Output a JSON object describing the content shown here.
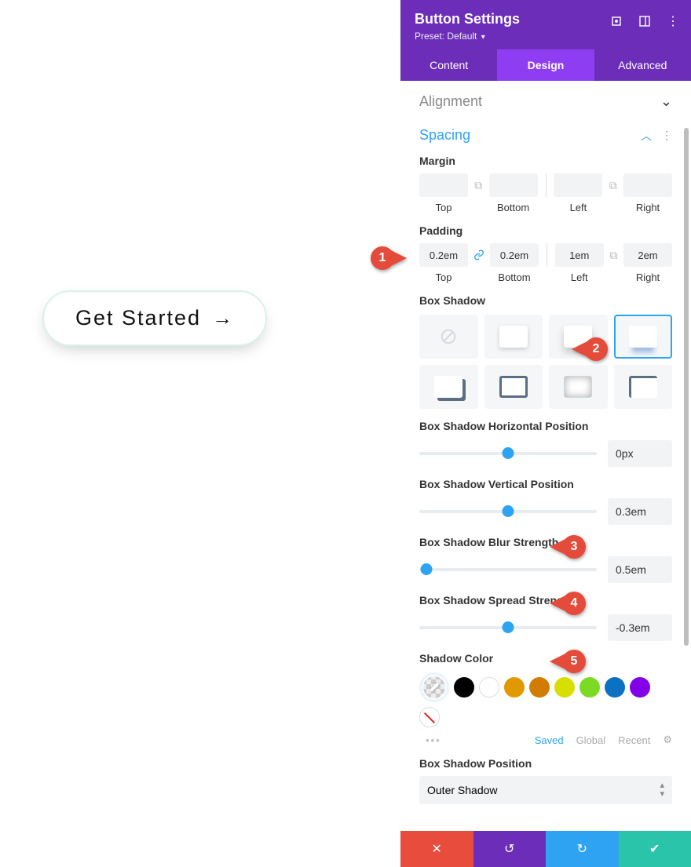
{
  "preview": {
    "button_label": "Get Started"
  },
  "header": {
    "title": "Button Settings",
    "preset_label": "Preset:",
    "preset_value": "Default"
  },
  "tabs": {
    "content": "Content",
    "design": "Design",
    "advanced": "Advanced",
    "active": "design"
  },
  "sections": {
    "alignment": "Alignment",
    "spacing": "Spacing"
  },
  "spacing": {
    "margin_label": "Margin",
    "padding_label": "Padding",
    "sub_top": "Top",
    "sub_bottom": "Bottom",
    "sub_left": "Left",
    "sub_right": "Right",
    "margin": {
      "top": "",
      "bottom": "",
      "left": "",
      "right": ""
    },
    "padding": {
      "top": "0.2em",
      "bottom": "0.2em",
      "left": "1em",
      "right": "2em"
    }
  },
  "box_shadow": {
    "label": "Box Shadow",
    "horizontal_label": "Box Shadow Horizontal Position",
    "horizontal_value": "0px",
    "vertical_label": "Box Shadow Vertical Position",
    "vertical_value": "0.3em",
    "blur_label": "Box Shadow Blur Strength",
    "blur_value": "0.5em",
    "spread_label": "Box Shadow Spread Strength",
    "spread_value": "-0.3em",
    "shadow_color_label": "Shadow Color",
    "tabs_saved": "Saved",
    "tabs_global": "Global",
    "tabs_recent": "Recent",
    "position_label": "Box Shadow Position",
    "position_value": "Outer Shadow"
  },
  "callouts": {
    "c1": "1",
    "c2": "2",
    "c3": "3",
    "c4": "4",
    "c5": "5"
  }
}
